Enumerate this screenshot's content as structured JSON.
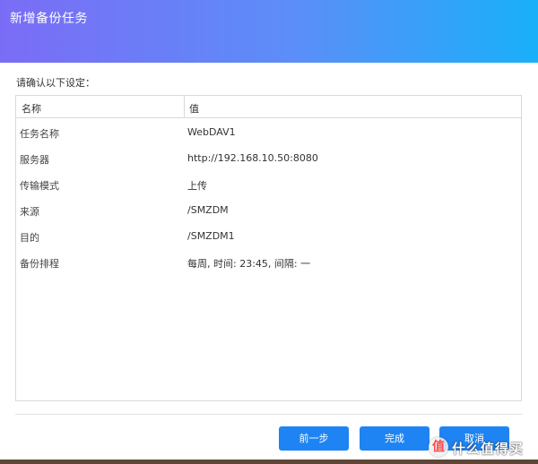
{
  "dialog": {
    "title": "新增备份任务",
    "prompt": "请确认以下设定："
  },
  "table": {
    "headers": [
      "名称",
      "值"
    ],
    "rows": [
      {
        "name": "任务名称",
        "value": "WebDAV1"
      },
      {
        "name": "服务器",
        "value": "http://192.168.10.50:8080"
      },
      {
        "name": "传输模式",
        "value": "上传"
      },
      {
        "name": "来源",
        "value": "/SMZDM"
      },
      {
        "name": "目的",
        "value": "/SMZDM1"
      },
      {
        "name": "备份排程",
        "value": "每周, 时间: 23:45, 间隔: 一"
      }
    ]
  },
  "buttons": {
    "prev": "前一步",
    "done": "完成",
    "cancel": "取消"
  },
  "watermark": {
    "icon_glyph": "值",
    "text": "什么值得买"
  },
  "colors": {
    "title_gradient_start": "#7b6cf6",
    "title_gradient_end": "#19b0f9",
    "button": "#1f84f3"
  }
}
